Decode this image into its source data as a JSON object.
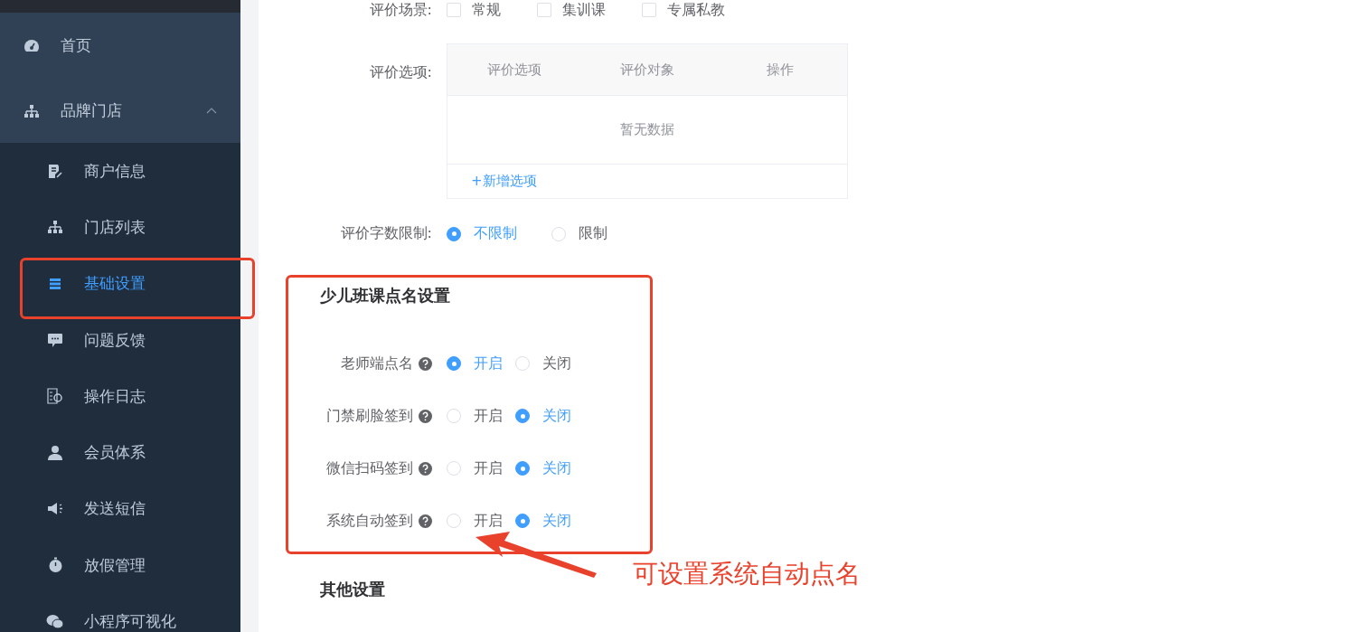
{
  "sidebar": {
    "items": [
      {
        "label": "首页",
        "selected": false
      },
      {
        "label": "品牌门店",
        "selected": false,
        "expanded": true,
        "children": [
          {
            "label": "商户信息",
            "selected": false
          },
          {
            "label": "门店列表",
            "selected": false
          },
          {
            "label": "基础设置",
            "selected": true
          },
          {
            "label": "问题反馈",
            "selected": false
          },
          {
            "label": "操作日志",
            "selected": false
          },
          {
            "label": "会员体系",
            "selected": false
          },
          {
            "label": "发送短信",
            "selected": false
          },
          {
            "label": "放假管理",
            "selected": false
          },
          {
            "label": "小程序可视化",
            "selected": false
          }
        ]
      }
    ]
  },
  "scene": {
    "label": "评价场景:",
    "options": [
      {
        "label": "常规",
        "checked": false
      },
      {
        "label": "集训课",
        "checked": false
      },
      {
        "label": "专属私教",
        "checked": false
      }
    ]
  },
  "options_table": {
    "label": "评价选项:",
    "columns": [
      "评价选项",
      "评价对象",
      "操作"
    ],
    "empty_text": "暂无数据",
    "add_link": "+新增选项"
  },
  "word_limit": {
    "label": "评价字数限制:",
    "options": [
      {
        "label": "不限制",
        "selected": true
      },
      {
        "label": "限制",
        "selected": false
      }
    ]
  },
  "roll_call": {
    "title": "少儿班课点名设置",
    "rows": [
      {
        "label": "老师端点名",
        "options": [
          {
            "label": "开启",
            "selected": true
          },
          {
            "label": "关闭",
            "selected": false
          }
        ]
      },
      {
        "label": "门禁刷脸签到",
        "options": [
          {
            "label": "开启",
            "selected": false
          },
          {
            "label": "关闭",
            "selected": true
          }
        ]
      },
      {
        "label": "微信扫码签到",
        "options": [
          {
            "label": "开启",
            "selected": false
          },
          {
            "label": "关闭",
            "selected": true
          }
        ]
      },
      {
        "label": "系统自动签到",
        "options": [
          {
            "label": "开启",
            "selected": false
          },
          {
            "label": "关闭",
            "selected": true
          }
        ]
      }
    ]
  },
  "other": {
    "title": "其他设置"
  },
  "annotation": {
    "text": "可设置系统自动点名"
  }
}
